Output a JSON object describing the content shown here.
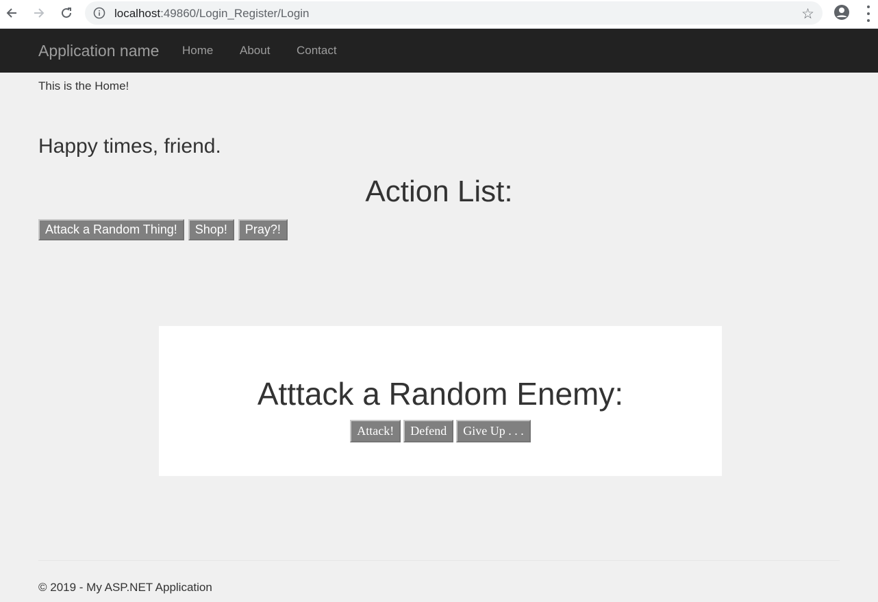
{
  "browser": {
    "url_host": "localhost",
    "url_rest": ":49860/Login_Register/Login"
  },
  "navbar": {
    "brand": "Application name",
    "links": [
      "Home",
      "About",
      "Contact"
    ]
  },
  "page": {
    "intro": "This is the Home!",
    "greeting": "Happy times, friend.",
    "action_title": "Action List:",
    "actions": [
      "Attack a Random Thing!",
      "Shop!",
      "Pray?!"
    ]
  },
  "panel": {
    "title": "Atttack a Random Enemy:",
    "buttons": [
      "Attack!",
      "Defend",
      "Give Up . . ."
    ]
  },
  "footer": {
    "text": "© 2019 - My ASP.NET Application"
  },
  "colors": {
    "navbar_bg": "#222222",
    "page_bg": "#f0f0f0",
    "button_bg": "#808080"
  }
}
